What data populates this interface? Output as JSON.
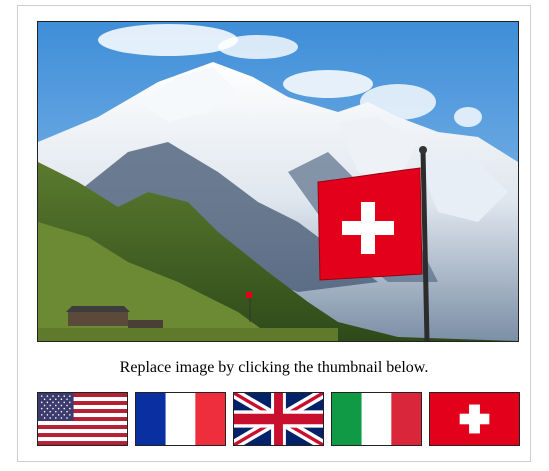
{
  "gallery": {
    "main_image": {
      "icon": "swiss-alps-photo",
      "alt": ""
    },
    "caption": "Replace image by clicking the thumbnail below.",
    "thumbnails": [
      {
        "icon": "usa-flag-icon"
      },
      {
        "icon": "france-flag-icon"
      },
      {
        "icon": "uk-flag-icon"
      },
      {
        "icon": "italy-flag-icon"
      },
      {
        "icon": "switzerland-flag-icon"
      }
    ]
  },
  "colors": {
    "frame_border": "#cfcfcf",
    "image_border": "#222222",
    "swiss_red": "#e3001b",
    "sky": "#5ea3e3"
  }
}
